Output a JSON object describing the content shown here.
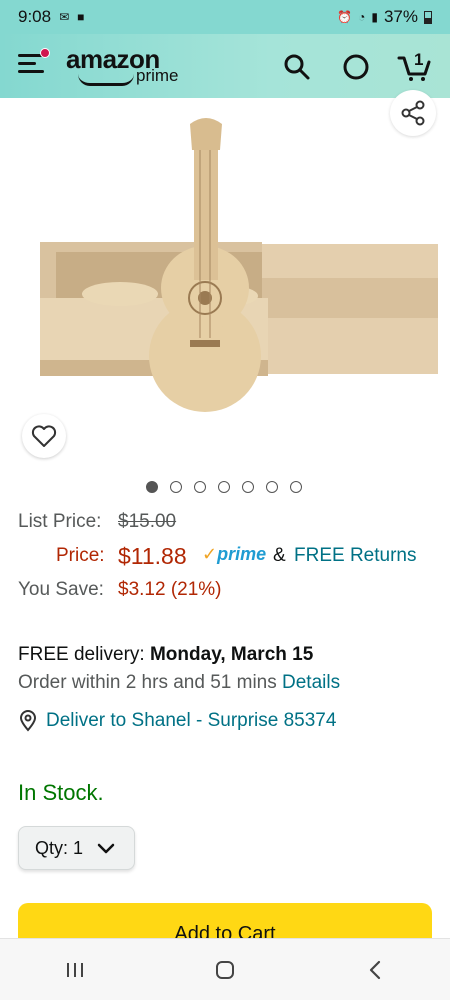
{
  "status_bar": {
    "time": "9:08",
    "battery": "37%"
  },
  "header": {
    "logo_text": "amazon",
    "logo_sub": "prime",
    "cart_count": "1"
  },
  "pricing": {
    "list_label": "List Price:",
    "list_value": "$15.00",
    "price_label": "Price:",
    "price_value": "$11.88",
    "prime_text": "prime",
    "amp": "&",
    "free_returns": "FREE Returns",
    "save_label": "You Save:",
    "save_value": "$3.12 (21%)"
  },
  "delivery": {
    "prefix": "FREE delivery: ",
    "date": "Monday, March 15",
    "order_within": "Order within 2 hrs and 51 mins ",
    "details": "Details",
    "deliver_to": "Deliver to Shanel - Surprise 85374"
  },
  "stock": "In Stock.",
  "qty": {
    "label": "Qty:",
    "value": "1"
  },
  "add_to_cart": "Add to Cart",
  "carousel": {
    "count": 7,
    "active": 0
  },
  "colors": {
    "prime_blue": "#1f9cd2",
    "price_red": "#b12704",
    "stock_green": "#007600",
    "link_teal": "#007185",
    "cart_yellow": "#ffd814"
  }
}
